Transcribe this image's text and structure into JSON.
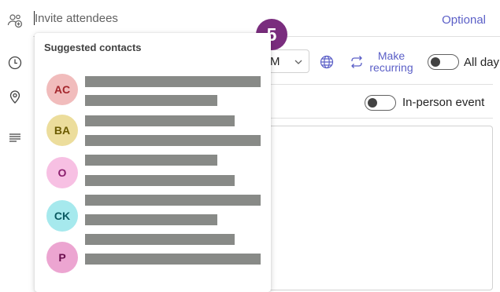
{
  "attendees": {
    "placeholder": "Invite attendees",
    "optional_label": "Optional"
  },
  "step_badge": "5",
  "suggestions": {
    "heading": "Suggested contacts",
    "contacts": [
      {
        "initials": "AC",
        "avatar_bg": "#f1bcbc",
        "avatar_fg": "#a4262c"
      },
      {
        "initials": "BA",
        "avatar_bg": "#ecdd9c",
        "avatar_fg": "#6b5b00"
      },
      {
        "initials": "O",
        "avatar_bg": "#f7c0e3",
        "avatar_fg": "#8b1f6e"
      },
      {
        "initials": "CK",
        "avatar_bg": "#a6e9ed",
        "avatar_fg": "#0b5a61"
      },
      {
        "initials": "P",
        "avatar_bg": "#eca5d1",
        "avatar_fg": "#6b0e4e"
      }
    ]
  },
  "time_dropdown": {
    "value": "M"
  },
  "recurring": {
    "label_line1": "Make",
    "label_line2": "recurring"
  },
  "all_day": {
    "label": "All day",
    "on": false
  },
  "in_person": {
    "label": "In-person event",
    "on": false
  },
  "colors": {
    "accent": "#5b5fc7",
    "badge": "#7a2d7e",
    "redaction": "#888a87"
  },
  "icons": {
    "rail": [
      "add-people-icon",
      "clock-icon",
      "location-pin-icon",
      "text-align-icon"
    ],
    "toolbar": [
      "globe-icon",
      "recurring-arrows-icon",
      "chevron-down-icon"
    ]
  }
}
